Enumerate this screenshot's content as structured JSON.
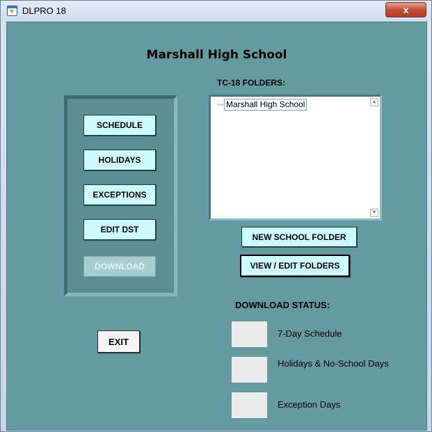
{
  "window": {
    "title": "DLPRO 18",
    "close_label": "x"
  },
  "header": {
    "school_name": "Marshall High School"
  },
  "actions": {
    "schedule": "SCHEDULE",
    "holidays": "HOLIDAYS",
    "exceptions": "EXCEPTIONS",
    "edit_dst": "EDIT DST",
    "download": "DOWNLOAD",
    "exit": "EXIT"
  },
  "folders": {
    "label": "TC-18 FOLDERS:",
    "items": [
      "Marshall High School"
    ],
    "new_folder": "NEW SCHOOL FOLDER",
    "view_edit": "VIEW / EDIT FOLDERS"
  },
  "download_status": {
    "label": "DOWNLOAD STATUS:",
    "items": [
      "7-Day Schedule",
      "Holidays & No-School Days",
      "Exception Days"
    ]
  },
  "colors": {
    "background": "#649ba0",
    "button": "#cdfcff",
    "status_box": "#ececec"
  },
  "icons": {
    "app": "dlpro-app-icon",
    "close": "close-icon"
  }
}
